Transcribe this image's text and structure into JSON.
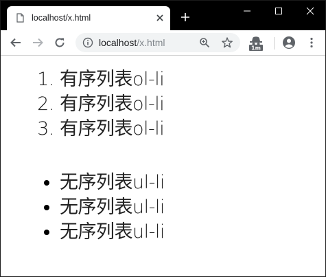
{
  "tab": {
    "title": "localhost/x.html",
    "favicon": "page-icon"
  },
  "window_controls": [
    "minimize-icon",
    "maximize-icon",
    "close-icon"
  ],
  "toolbar": {
    "url_host": "localhost",
    "url_path": "/x.html",
    "icons": [
      "back-arrow-icon",
      "forward-arrow-icon",
      "reload-icon",
      "info-icon",
      "zoom-icon",
      "star-icon",
      "extension-icon",
      "profile-icon",
      "menu-icon"
    ],
    "extension_badge": "1m"
  },
  "page": {
    "ordered_items": [
      "有序列表ol-li",
      "有序列表ol-li",
      "有序列表ol-li"
    ],
    "unordered_items": [
      "无序列表ul-li",
      "无序列表ul-li",
      "无序列表ul-li"
    ]
  },
  "colors": {
    "titlebar": "#000000",
    "omnibox": "#f1f3f4",
    "text": "#222222"
  }
}
